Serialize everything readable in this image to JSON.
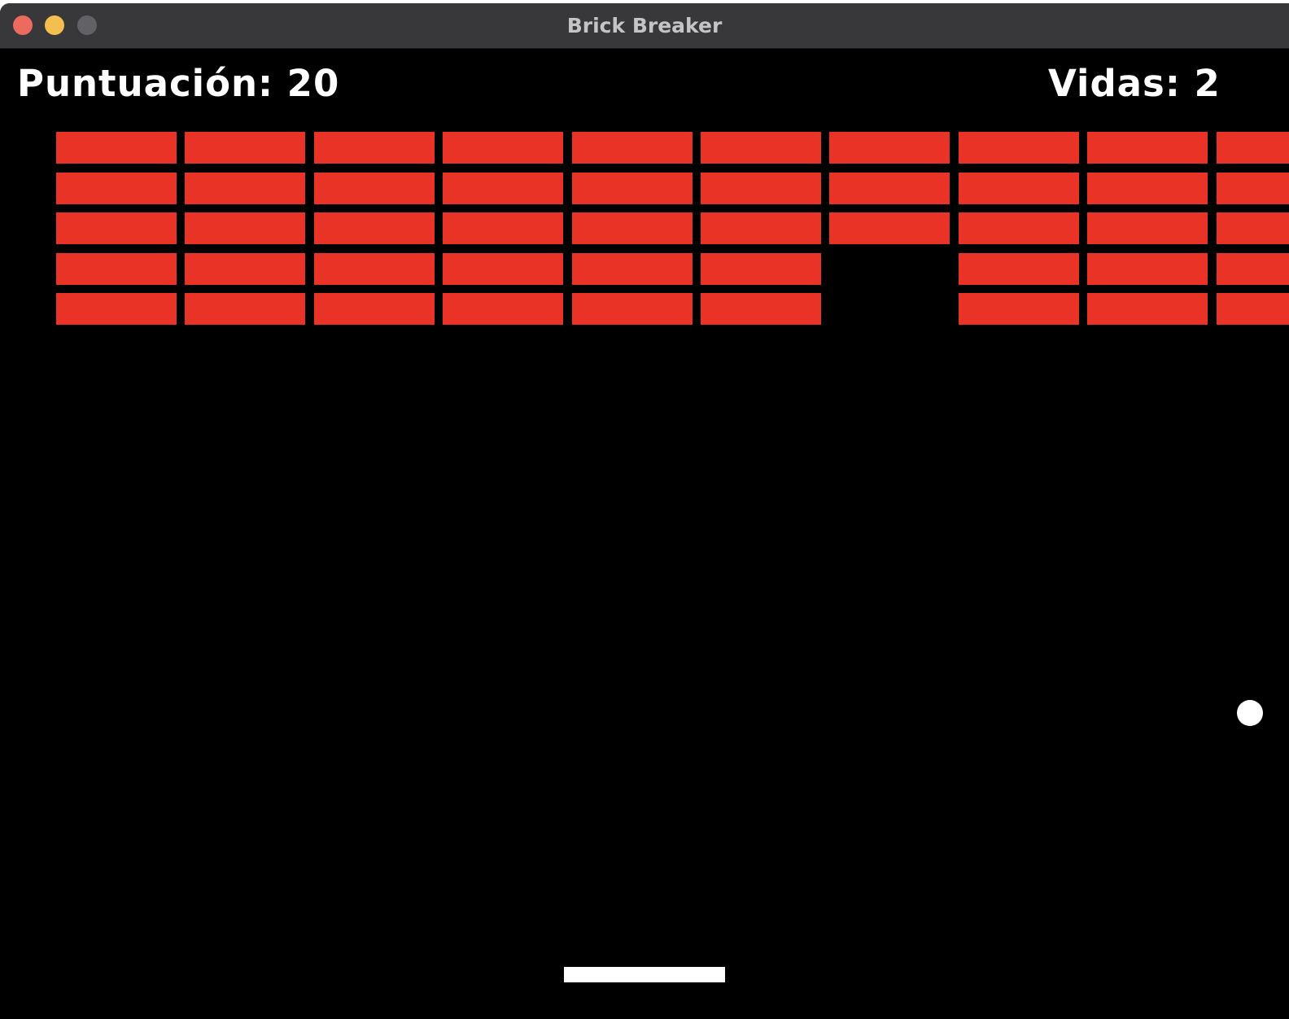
{
  "window": {
    "title": "Brick Breaker",
    "controls": {
      "close_color": "#ed6a5e",
      "minimize_color": "#f5bf4f",
      "zoom_color": "#626266"
    }
  },
  "hud": {
    "score_text": "Puntuación: 20",
    "lives_text": "Vidas: 2"
  },
  "game": {
    "background_color": "#000000",
    "brick_color": "#e83326",
    "brick_grid": {
      "rows": 5,
      "columns_visible": 10,
      "present": [
        [
          1,
          1,
          1,
          1,
          1,
          1,
          1,
          1,
          1,
          1
        ],
        [
          1,
          1,
          1,
          1,
          1,
          1,
          1,
          1,
          1,
          1
        ],
        [
          1,
          1,
          1,
          1,
          1,
          1,
          1,
          1,
          1,
          1
        ],
        [
          1,
          1,
          1,
          1,
          1,
          1,
          0,
          1,
          1,
          1
        ],
        [
          1,
          1,
          1,
          1,
          1,
          1,
          0,
          1,
          1,
          1
        ]
      ]
    },
    "ball_color": "#ffffff",
    "paddle_color": "#ffffff"
  }
}
